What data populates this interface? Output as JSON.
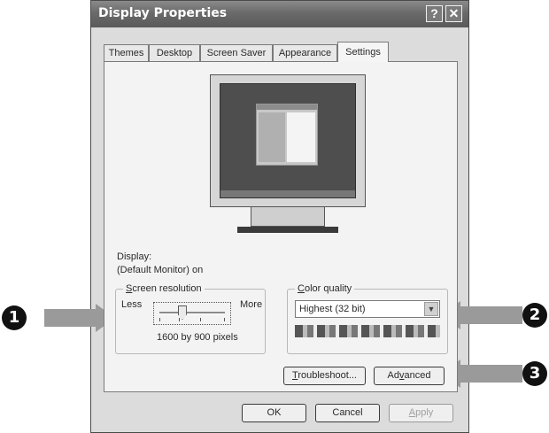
{
  "window": {
    "title": "Display Properties",
    "help_btn": "?",
    "close_btn": "✕"
  },
  "tabs": [
    {
      "label": "Themes"
    },
    {
      "label": "Desktop"
    },
    {
      "label": "Screen Saver"
    },
    {
      "label": "Appearance"
    },
    {
      "label": "Settings"
    }
  ],
  "display": {
    "label": "Display:",
    "value": "(Default Monitor) on"
  },
  "resolution": {
    "legend_first": "S",
    "legend_rest": "creen resolution",
    "less": "Less",
    "more": "More",
    "value_text": "1600 by 900 pixels",
    "slider_level": 0.35
  },
  "color_quality": {
    "legend_first": "C",
    "legend_rest": "olor quality",
    "selected": "Highest (32 bit)"
  },
  "buttons": {
    "troubleshoot_first": "T",
    "troubleshoot_rest": "roubleshoot...",
    "advanced_pre": "Ad",
    "advanced_key": "v",
    "advanced_post": "anced",
    "ok": "OK",
    "cancel": "Cancel",
    "apply_first": "A",
    "apply_rest": "pply"
  },
  "callouts": {
    "one": "1",
    "two": "2",
    "three": "3"
  },
  "colors": {
    "title_bar": "#6a6a6a",
    "dialog_bg": "#dcdcdc",
    "arrow": "#9a9a9a",
    "callout": "#111111"
  }
}
